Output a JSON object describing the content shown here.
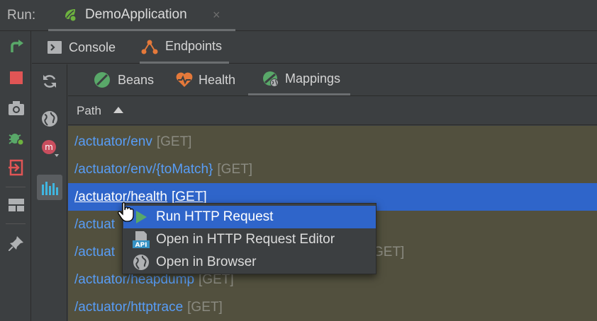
{
  "run_bar": {
    "label": "Run:",
    "tab_title": "DemoApplication",
    "close_glyph": "×"
  },
  "left_toolbar": [
    "rerun-icon",
    "stop-icon",
    "screenshot-camera-icon",
    "debug-bug-icon",
    "exit-icon",
    "layout-icon",
    "pin-icon"
  ],
  "sub_tabs": [
    {
      "label": "Console",
      "icon": "console-icon",
      "active": false
    },
    {
      "label": "Endpoints",
      "icon": "endpoints-icon",
      "active": true
    }
  ],
  "left_column": [
    "refresh-icon",
    "globe-icon",
    "module-icon",
    "diagram-icon"
  ],
  "map_tabs": [
    {
      "label": "Beans",
      "icon": "beans-icon",
      "active": false
    },
    {
      "label": "Health",
      "icon": "health-icon",
      "active": false
    },
    {
      "label": "Mappings",
      "icon": "mappings-icon",
      "active": true
    }
  ],
  "table": {
    "header": "Path",
    "sort": "ascending",
    "rows": [
      {
        "path": "/actuator/env",
        "method": "[GET]"
      },
      {
        "path": "/actuator/env/{toMatch}",
        "method": "[GET]"
      },
      {
        "path": "/actuator/health",
        "method": "[GET]"
      },
      {
        "path": "/actuat",
        "method": ""
      },
      {
        "path": "/actuat",
        "method": "GET]"
      },
      {
        "path": "/actuator/heapdump",
        "method": "[GET]"
      },
      {
        "path": "/actuator/httptrace",
        "method": "[GET]"
      }
    ],
    "selected_index": 2
  },
  "context_menu": {
    "items": [
      {
        "label": "Run HTTP Request",
        "icon": "run-play-icon"
      },
      {
        "label": "Open in HTTP Request Editor",
        "icon": "api-file-icon"
      },
      {
        "label": "Open in Browser",
        "icon": "globe-icon"
      }
    ]
  },
  "colors": {
    "background": "#3c3f41",
    "list_background": "#52503e",
    "selection": "#2f65ca",
    "link": "#589df6",
    "method": "#8a8a80"
  }
}
